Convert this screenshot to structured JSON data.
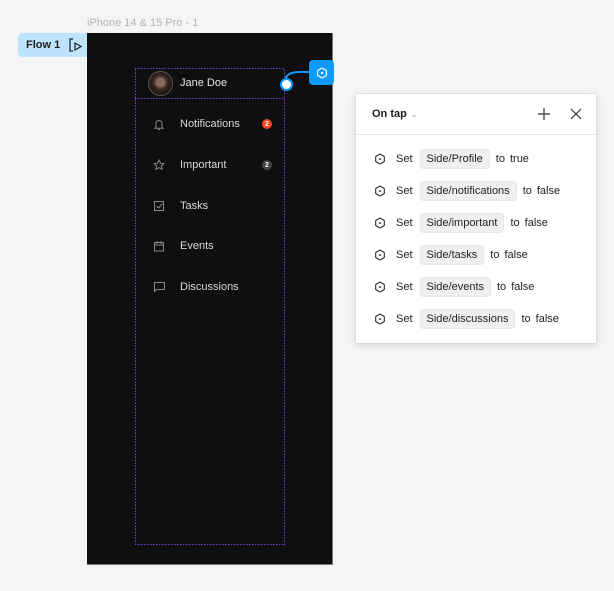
{
  "canvas": {
    "frame_label": "iPhone 14 & 15 Pro - 1",
    "flow": {
      "label": "Flow 1",
      "icon": "play-flow-icon"
    }
  },
  "app": {
    "profile": {
      "name": "Jane Doe",
      "avatar": "avatar-photo"
    },
    "nav": [
      {
        "label": "Notifications",
        "icon": "bell-icon",
        "badge": "2",
        "badge_color": "#f24822"
      },
      {
        "label": "Important",
        "icon": "star-icon",
        "badge": "2",
        "badge_color": "#444444"
      },
      {
        "label": "Tasks",
        "icon": "checkbox-icon"
      },
      {
        "label": "Events",
        "icon": "calendar-icon"
      },
      {
        "label": "Discussions",
        "icon": "chat-icon"
      }
    ]
  },
  "interaction_panel": {
    "trigger": "On tap",
    "actions": [
      {
        "verb": "Set",
        "variable": "Side/Profile",
        "to": "to",
        "value": "true"
      },
      {
        "verb": "Set",
        "variable": "Side/notifications",
        "to": "to",
        "value": "false"
      },
      {
        "verb": "Set",
        "variable": "Side/important",
        "to": "to",
        "value": "false"
      },
      {
        "verb": "Set",
        "variable": "Side/tasks",
        "to": "to",
        "value": "false"
      },
      {
        "verb": "Set",
        "variable": "Side/events",
        "to": "to",
        "value": "false"
      },
      {
        "verb": "Set",
        "variable": "Side/discussions",
        "to": "to",
        "value": "false"
      }
    ]
  },
  "colors": {
    "accent": "#0d99ff",
    "selection": "#7b3fe4",
    "frame_bg": "#0f0f0f"
  }
}
